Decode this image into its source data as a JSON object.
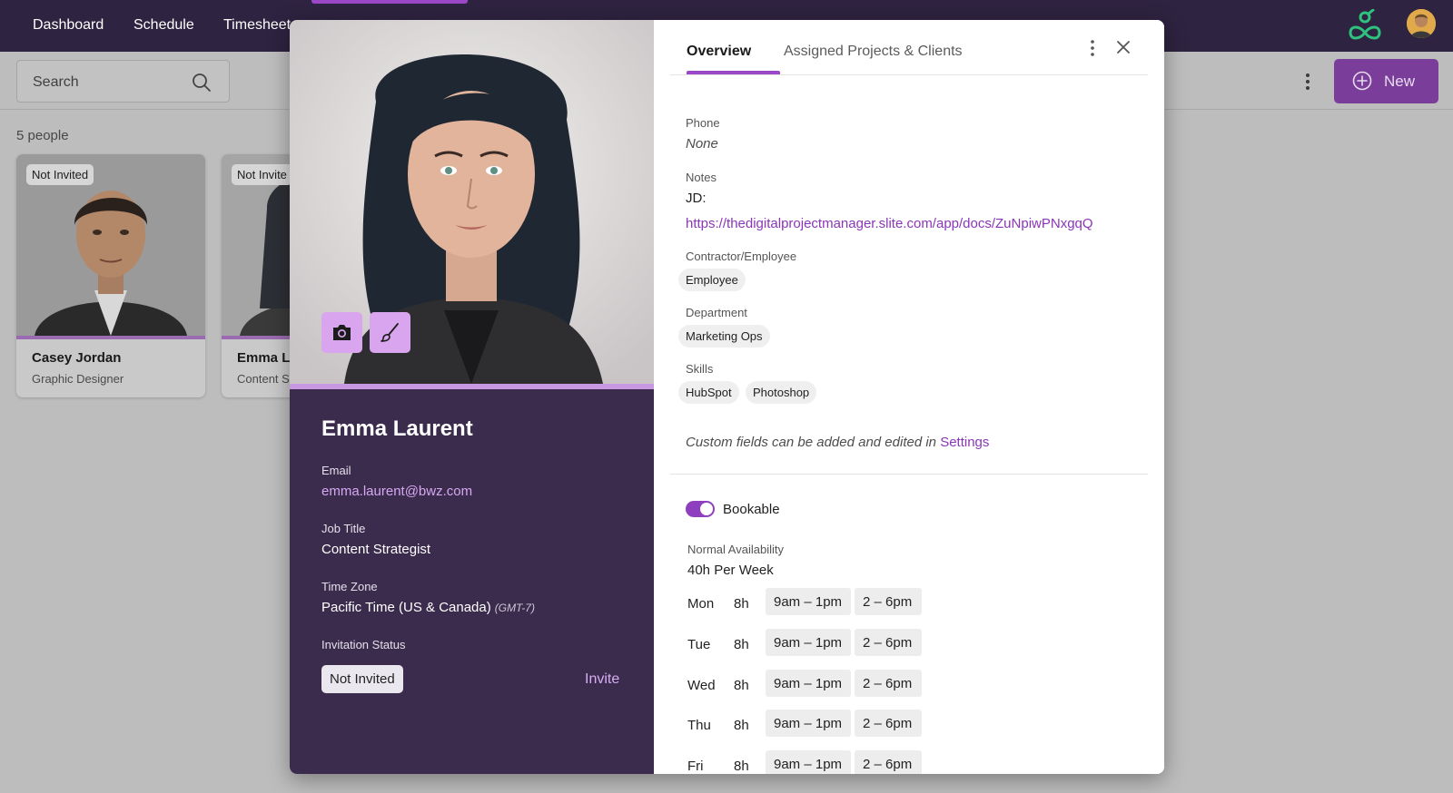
{
  "nav": {
    "items": [
      "Dashboard",
      "Schedule",
      "Timesheet"
    ]
  },
  "toolbar": {
    "search_placeholder": "Search",
    "new_label": "New"
  },
  "people_count": "5 people",
  "cards": [
    {
      "badge": "Not Invited",
      "name": "Casey Jordan",
      "role": "Graphic Designer"
    },
    {
      "badge": "Not Invite",
      "name": "Emma L",
      "role": "Content S"
    }
  ],
  "modal": {
    "person": {
      "name": "Emma Laurent",
      "email_label": "Email",
      "email": "emma.laurent@bwz.com",
      "job_title_label": "Job Title",
      "job_title": "Content Strategist",
      "time_zone_label": "Time Zone",
      "time_zone": "Pacific Time (US & Canada)",
      "time_zone_offset": "(GMT-7)",
      "invitation_status_label": "Invitation Status",
      "invitation_status": "Not Invited",
      "invite_label": "Invite"
    },
    "tabs": [
      "Overview",
      "Assigned Projects & Clients"
    ],
    "overview": {
      "phone_label": "Phone",
      "phone": "None",
      "notes_label": "Notes",
      "notes_line1": "JD:",
      "notes_link": "https://thedigitalprojectmanager.slite.com/app/docs/ZuNpiwPNxgqQ",
      "contractor_label": "Contractor/Employee",
      "contractor": "Employee",
      "department_label": "Department",
      "department": "Marketing Ops",
      "skills_label": "Skills",
      "skills": [
        "HubSpot",
        "Photoshop"
      ],
      "custom_fields_text": "Custom fields can be added and edited in",
      "settings_link": "Settings",
      "bookable_label": "Bookable",
      "bookable": true,
      "availability_label": "Normal Availability",
      "availability_total": "40h Per Week",
      "days": [
        {
          "day": "Mon",
          "hours": "8h",
          "slots": [
            "9am – 1pm",
            "2 – 6pm"
          ]
        },
        {
          "day": "Tue",
          "hours": "8h",
          "slots": [
            "9am – 1pm",
            "2 – 6pm"
          ]
        },
        {
          "day": "Wed",
          "hours": "8h",
          "slots": [
            "9am – 1pm",
            "2 – 6pm"
          ]
        },
        {
          "day": "Thu",
          "hours": "8h",
          "slots": [
            "9am – 1pm",
            "2 – 6pm"
          ]
        },
        {
          "day": "Fri",
          "hours": "8h",
          "slots": [
            "9am – 1pm",
            "2 – 6pm"
          ]
        }
      ]
    }
  },
  "colors": {
    "topbar": "#2e2340",
    "accent": "#9a48c7",
    "left_panel": "#3b2b4d",
    "logo": "#2ec27e"
  }
}
